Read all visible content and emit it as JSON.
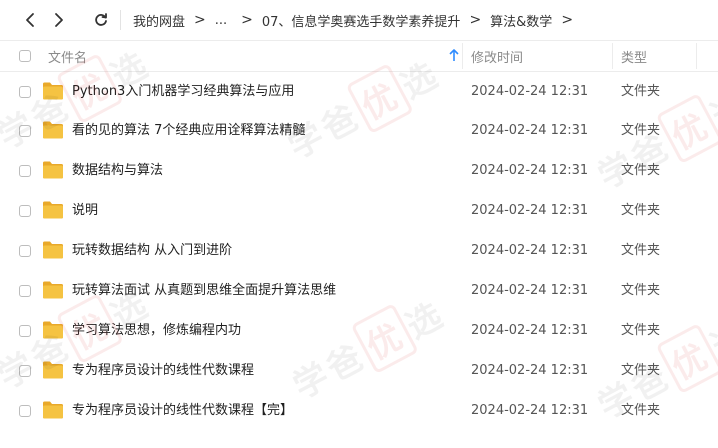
{
  "toolbar": {
    "back_icon": "chevron-left-icon",
    "forward_icon": "chevron-right-icon",
    "refresh_icon": "refresh-icon",
    "breadcrumb": [
      "我的网盘",
      "...",
      "07、信息学奥赛选手数学素养提升",
      "算法&数学"
    ],
    "separator": ">"
  },
  "table": {
    "columns": {
      "name": "文件名",
      "modified": "修改时间",
      "type": "类型"
    },
    "sort_icon": "sort-ascending-icon",
    "rows": [
      {
        "name": "Python3入门机器学习经典算法与应用",
        "modified": "2024-02-24 12:31",
        "type": "文件夹"
      },
      {
        "name": "看的见的算法 7个经典应用诠释算法精髓",
        "modified": "2024-02-24 12:31",
        "type": "文件夹"
      },
      {
        "name": "数据结构与算法",
        "modified": "2024-02-24 12:31",
        "type": "文件夹"
      },
      {
        "name": "说明",
        "modified": "2024-02-24 12:31",
        "type": "文件夹"
      },
      {
        "name": "玩转数据结构 从入门到进阶",
        "modified": "2024-02-24 12:31",
        "type": "文件夹"
      },
      {
        "name": "玩转算法面试 从真题到思维全面提升算法思维",
        "modified": "2024-02-24 12:31",
        "type": "文件夹"
      },
      {
        "name": "学习算法思想，修炼编程内功",
        "modified": "2024-02-24 12:31",
        "type": "文件夹"
      },
      {
        "name": "专为程序员设计的线性代数课程",
        "modified": "2024-02-24 12:31",
        "type": "文件夹"
      },
      {
        "name": "专为程序员设计的线性代数课程【完】",
        "modified": "2024-02-24 12:31",
        "type": "文件夹"
      }
    ]
  },
  "watermark": {
    "pre": "学爸",
    "mark": "优",
    "post": "选"
  },
  "colors": {
    "folder": "#f5c342",
    "folder_tab": "#e9a92a",
    "sort": "#2f8cff"
  }
}
